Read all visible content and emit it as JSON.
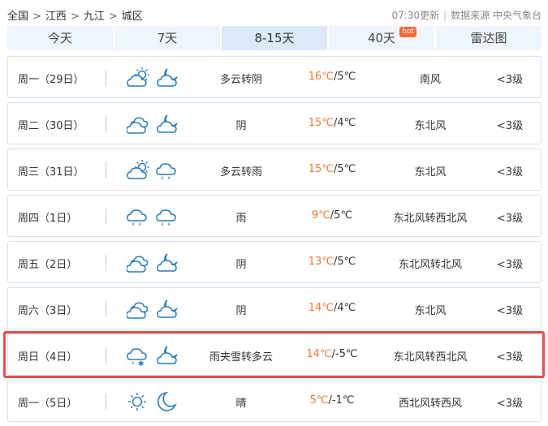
{
  "breadcrumb": {
    "items": [
      "全国",
      "江西",
      "九江",
      "城区"
    ],
    "separator": ">"
  },
  "meta": {
    "updated": "07:30更新",
    "source": "数据来源 中央气象台"
  },
  "tabs": [
    {
      "label": "今天"
    },
    {
      "label": "7天"
    },
    {
      "label": "8-15天",
      "active": true
    },
    {
      "label": "40天",
      "badge": "hot"
    },
    {
      "label": "雷达图"
    }
  ],
  "days": [
    {
      "day": "周一（29日）",
      "icon_day": "partly-cloudy-day-icon",
      "icon_night": "partly-cloudy-night-icon",
      "desc": "多云转阴",
      "high": "16℃",
      "low": "/5℃",
      "wind": "南风",
      "level": "<3级"
    },
    {
      "day": "周二（30日）",
      "icon_day": "cloudy-icon",
      "icon_night": "partly-cloudy-night-icon",
      "desc": "阴",
      "high": "15℃",
      "low": "/4℃",
      "wind": "东北风",
      "level": "<3级"
    },
    {
      "day": "周三（31日）",
      "icon_day": "partly-cloudy-day-icon",
      "icon_night": "rain-icon",
      "desc": "多云转雨",
      "high": "15℃",
      "low": "/5℃",
      "wind": "东北风",
      "level": "<3级"
    },
    {
      "day": "周四（1日）",
      "icon_day": "rain-icon",
      "icon_night": "rain-icon",
      "desc": "雨",
      "high": "9℃",
      "low": "/5℃",
      "wind": "东北风转西北风",
      "level": "<3级"
    },
    {
      "day": "周五（2日）",
      "icon_day": "cloudy-icon",
      "icon_night": "partly-cloudy-night-icon",
      "desc": "阴",
      "high": "13℃",
      "low": "/5℃",
      "wind": "东北风转北风",
      "level": "<3级"
    },
    {
      "day": "周六（3日）",
      "icon_day": "cloudy-icon",
      "icon_night": "partly-cloudy-night-icon",
      "desc": "阴",
      "high": "14℃",
      "low": "/4℃",
      "wind": "东北风",
      "level": "<3级"
    },
    {
      "day": "周日（4日）",
      "icon_day": "sleet-icon",
      "icon_night": "partly-cloudy-night-icon",
      "desc": "雨夹雪转多云",
      "high": "14℃",
      "low": "/-5℃",
      "wind": "东北风转西北风",
      "level": "<3级",
      "highlighted": true
    },
    {
      "day": "周一（5日）",
      "icon_day": "sunny-icon",
      "icon_night": "moon-icon",
      "desc": "晴",
      "high": "5℃",
      "low": "/-1℃",
      "wind": "西北风转西风",
      "level": "<3级"
    }
  ],
  "colors": {
    "tab_bg": "#eef5fc",
    "tab_active_bg": "#dce9f7",
    "row_border": "#d6e2ef",
    "high_temp": "#f07a34",
    "hot_badge": "#f26b3a",
    "highlight_border": "#e84c4c",
    "icon_stroke": "#2c7bb6"
  }
}
